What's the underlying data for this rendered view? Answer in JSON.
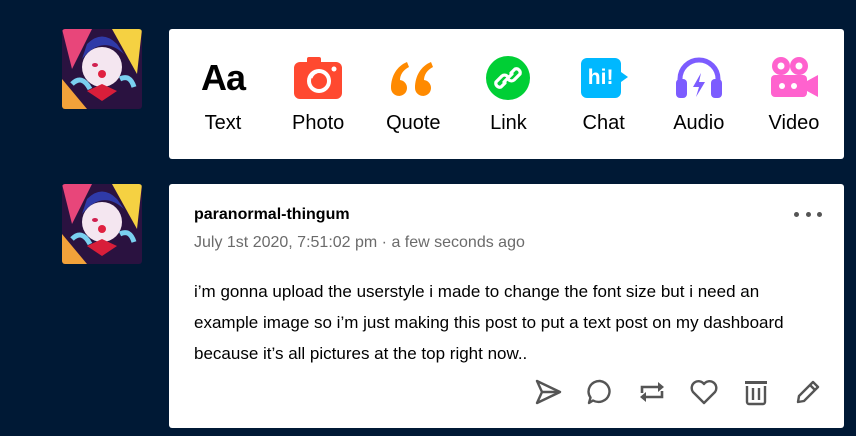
{
  "composer": {
    "items": [
      {
        "label": "Text",
        "icon": "text-icon",
        "color": "#000000"
      },
      {
        "label": "Photo",
        "icon": "camera-icon",
        "color": "#ff4930"
      },
      {
        "label": "Quote",
        "icon": "quote-icon",
        "color": "#ff8a00"
      },
      {
        "label": "Link",
        "icon": "link-icon",
        "color": "#00cf35"
      },
      {
        "label": "Chat",
        "icon": "chat-icon",
        "color": "#00b8ff"
      },
      {
        "label": "Audio",
        "icon": "headphones-icon",
        "color": "#7c5cff"
      },
      {
        "label": "Video",
        "icon": "video-camera-icon",
        "color": "#ff62ce"
      }
    ],
    "text_glyph": "Aa",
    "chat_glyph": "hi!"
  },
  "post": {
    "blog_name": "paranormal-thingum",
    "timestamp": "July 1st 2020, 7:51:02 pm · a few seconds ago",
    "body": "i’m  gonna upload the userstyle i made to change the font size  but i need an example image so  i’m just making this post to put a text post on my dashboard because it’s all pictures at the top right now..",
    "actions": [
      "share-icon",
      "reply-icon",
      "reblog-icon",
      "like-icon",
      "delete-icon",
      "edit-icon"
    ]
  }
}
